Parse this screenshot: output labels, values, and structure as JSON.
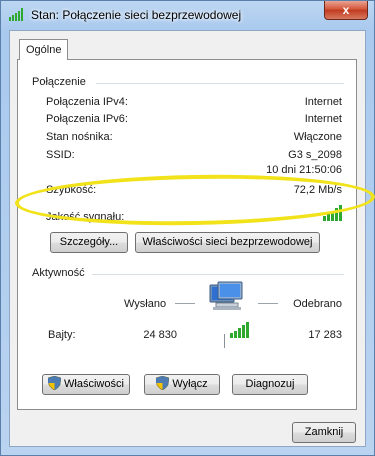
{
  "window": {
    "title": "Stan: Połączenie sieci bezprzewodowej",
    "close_label": "x"
  },
  "tabs": [
    {
      "label": "Ogólne",
      "selected": true
    }
  ],
  "connection": {
    "group_label": "Połączenie",
    "rows": [
      {
        "label": "Połączenia IPv4:",
        "value": "Internet"
      },
      {
        "label": "Połączenia IPv6:",
        "value": "Internet"
      },
      {
        "label": "Stan nośnika:",
        "value": "Włączone"
      },
      {
        "label": "SSID:",
        "value": "G3 s_2098"
      },
      {
        "label": "",
        "value": "10 dni 21:50:06"
      },
      {
        "label": "Szybkość:",
        "value": "72,2 Mb/s"
      }
    ],
    "signal_label": "Jakość sygnału:",
    "signal_level": 1.0,
    "details_button": "Szczegóły...",
    "wireless_props_button": "Właściwości sieci bezprzewodowej"
  },
  "activity": {
    "group_label": "Aktywność",
    "sent_label": "Wysłano",
    "received_label": "Odebrano",
    "bytes_label": "Bajty:",
    "bytes_sent": "24 830",
    "bytes_received": "17 283"
  },
  "actions": {
    "properties_button": "Właściwości",
    "disable_button": "Wyłącz",
    "diagnose_button": "Diagnozuj"
  },
  "footer": {
    "close_button": "Zamknij"
  },
  "colors": {
    "highlight": "#f1e21a",
    "signal_green": "#2ea82e",
    "title_bg": "#a9c9ee"
  }
}
